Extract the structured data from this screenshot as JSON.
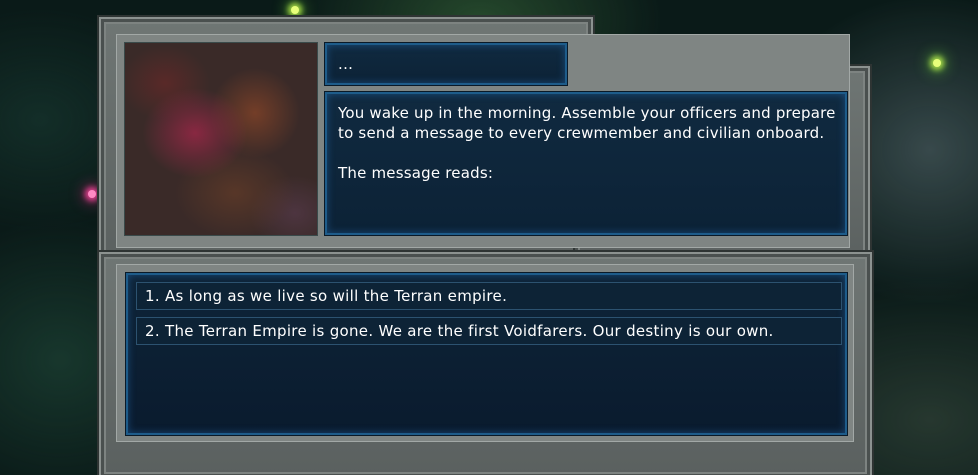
{
  "event": {
    "title": "...",
    "body_paragraphs": [
      "You wake up in the morning. Assemble your officers and prepare to send a message to every crewmember and civilian onboard.",
      "The message reads:"
    ],
    "choices": [
      {
        "label": "1. As long as we live so will the Terran empire."
      },
      {
        "label": "2. The Terran Empire is gone. We are the first Voidfarers. Our destiny is our own."
      }
    ]
  },
  "colors": {
    "panel_background": "#0c2236",
    "panel_border": "#1e5c8a",
    "frame_gray": "#6f7674",
    "text": "#ffffff"
  }
}
